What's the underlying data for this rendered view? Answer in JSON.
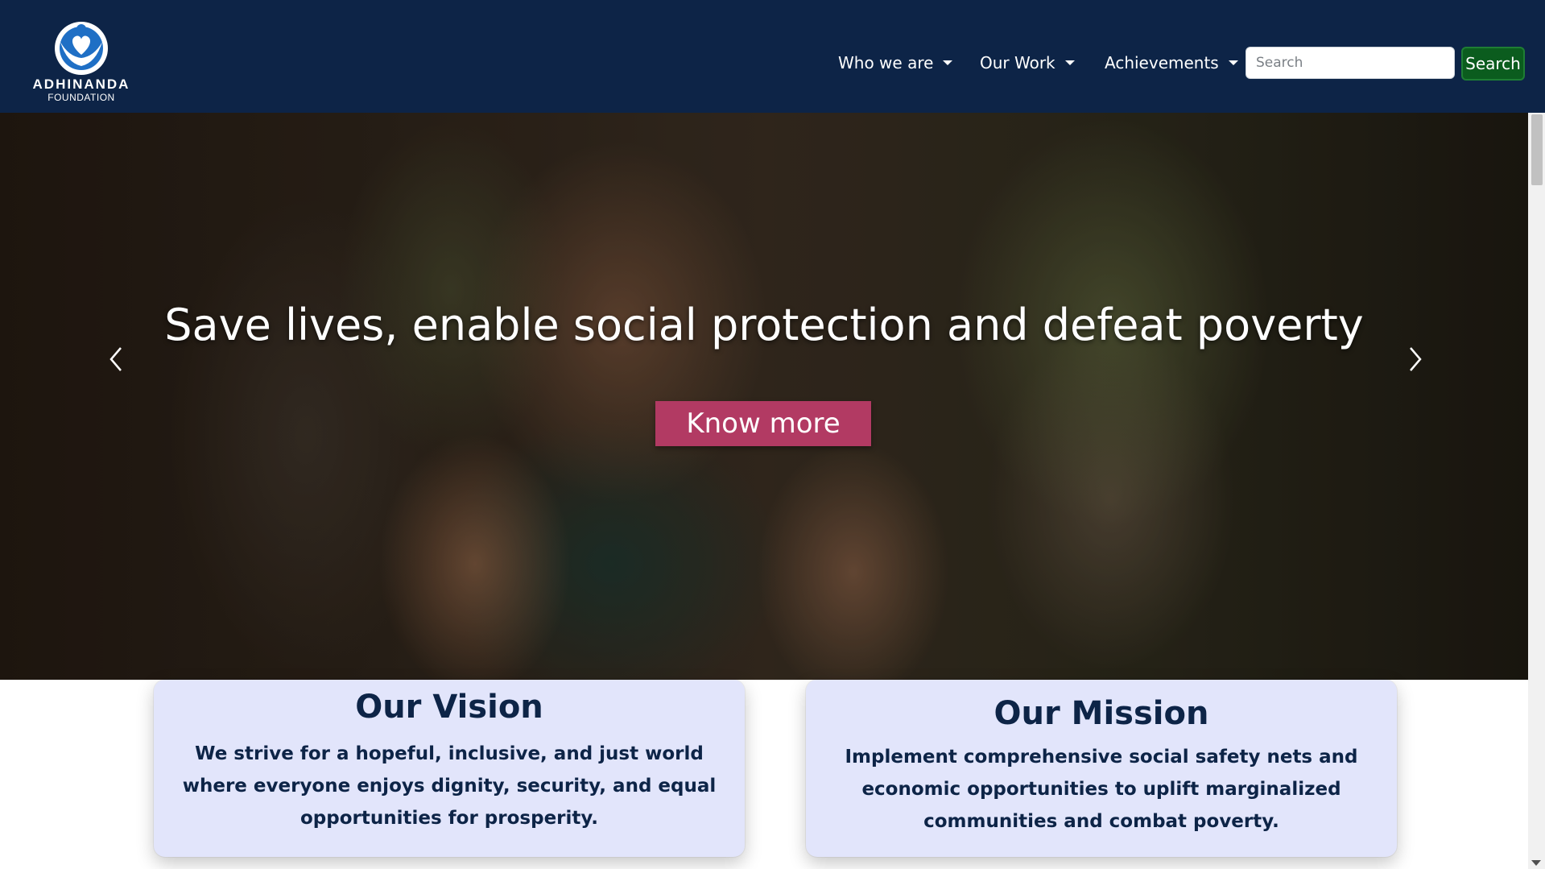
{
  "brand": {
    "name": "ADHINANDA",
    "subtitle": "FOUNDATION",
    "logo_icon": "hands-heart-logo"
  },
  "nav": {
    "items": [
      {
        "label": "Who we are",
        "icon": "caret-down-icon"
      },
      {
        "label": "Our Work",
        "icon": "caret-down-icon"
      },
      {
        "label": "Achievements",
        "icon": "caret-down-icon"
      }
    ],
    "search_placeholder": "Search",
    "search_value": "",
    "search_button": "Search"
  },
  "hero": {
    "title": "Save lives, enable social protection and defeat poverty",
    "button": "Know more",
    "prev_icon": "chevron-left-icon",
    "next_icon": "chevron-right-icon"
  },
  "vision": {
    "title": "Our Vision",
    "text": "We strive for a hopeful, inclusive, and just world where everyone enjoys dignity, security, and equal opportunities for prosperity."
  },
  "mission": {
    "title": "Our Mission",
    "text": "Implement comprehensive social safety nets and economic opportunities to uplift marginalized communities and combat poverty."
  },
  "colors": {
    "navbar": "#0d2447",
    "search_button": "#0b5c1e",
    "cta_button": "#b23a63",
    "card_background": "#e2e5fb",
    "card_text": "#0d2447"
  }
}
